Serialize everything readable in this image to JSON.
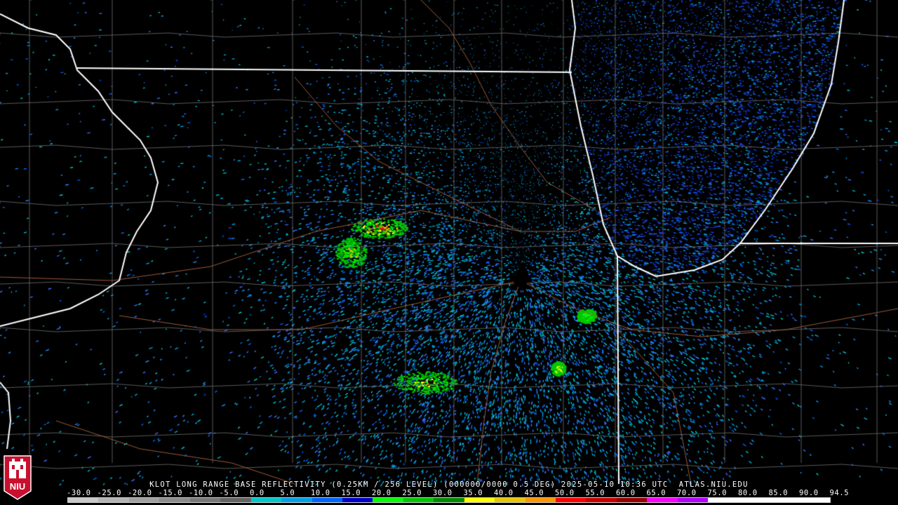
{
  "product": {
    "caption": "KLOT LONG RANGE BASE REFLECTIVITY (0.25KM / 256 LEVEL) (000000/0000 0.5 DEG) 2025-05-10 10:36 UTC  ATLAS.NIU.EDU"
  },
  "logo": {
    "text": "NIU",
    "colors": {
      "bg": "#c8102e",
      "fg": "#ffffff"
    }
  },
  "scale": {
    "labels": [
      "-30.0",
      "-25.0",
      "-20.0",
      "-15.0",
      "-10.0",
      "-5.0",
      "0.0",
      "5.0",
      "10.0",
      "15.0",
      "20.0",
      "25.0",
      "30.0",
      "35.0",
      "40.0",
      "45.0",
      "50.0",
      "55.0",
      "60.0",
      "65.0",
      "70.0",
      "75.0",
      "80.0",
      "85.0",
      "90.0",
      "94.5"
    ],
    "colors": [
      "#c8c8c8",
      "#b4b4b4",
      "#a0a0a0",
      "#8c8c8c",
      "#787878",
      "#646464",
      "#00c8c8",
      "#00a0e6",
      "#0064ff",
      "#0000c8",
      "#00ff00",
      "#00c800",
      "#008c00",
      "#ffff00",
      "#e6c800",
      "#ff9600",
      "#ff0000",
      "#c80000",
      "#960000",
      "#ff00ff",
      "#b400ff",
      "#ffffff",
      "#ffffff",
      "#ffffff",
      "#ffffff"
    ]
  },
  "map": {
    "colors": {
      "background": "#000000",
      "state_border": "#ffffff",
      "county_line": "#707070",
      "highway": "#9a5a3a"
    },
    "radar_site": "KLOT"
  }
}
